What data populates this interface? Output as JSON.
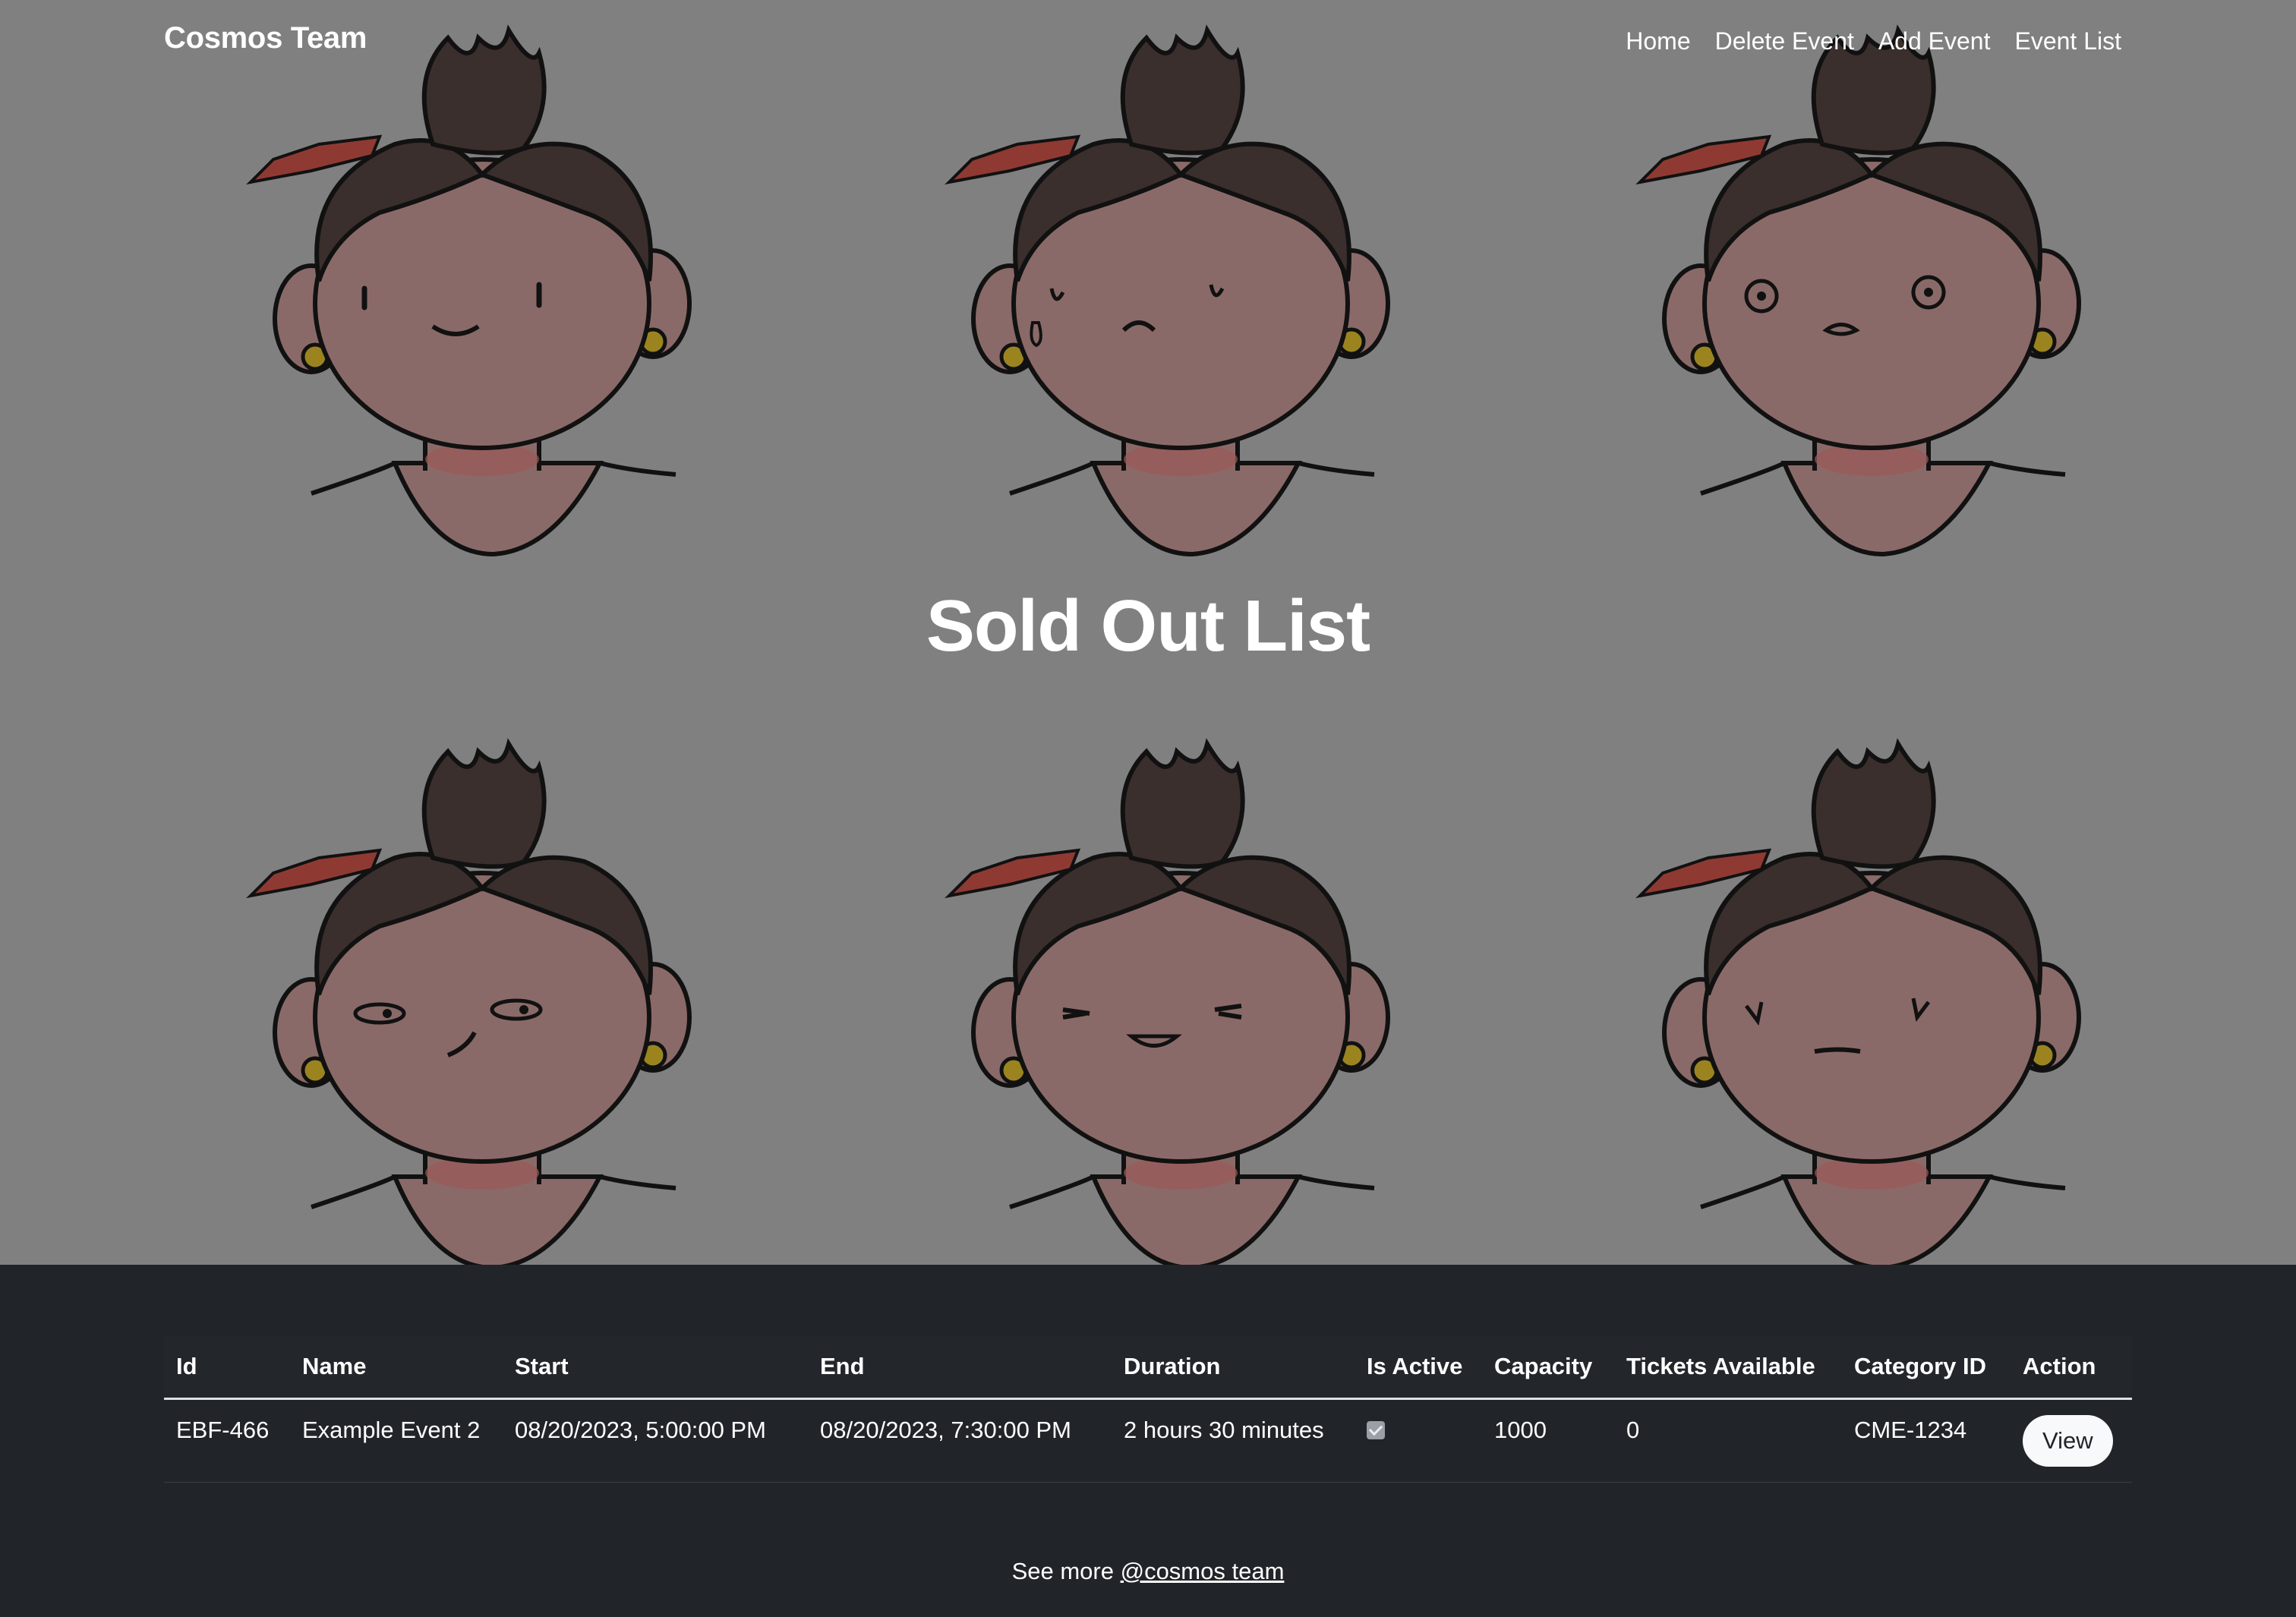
{
  "navbar": {
    "brand": "Cosmos Team",
    "links": [
      "Home",
      "Delete Event",
      "Add Event",
      "Event List"
    ]
  },
  "hero": {
    "title": "Sold Out List",
    "faces": [
      {
        "icon": "smiling-face-icon"
      },
      {
        "icon": "crying-face-icon"
      },
      {
        "icon": "surprised-face-icon"
      },
      {
        "icon": "smirking-face-icon"
      },
      {
        "icon": "happy-squint-face-icon"
      },
      {
        "icon": "angry-face-icon"
      }
    ]
  },
  "table": {
    "headers": [
      "Id",
      "Name",
      "Start",
      "End",
      "Duration",
      "Is Active",
      "Capacity",
      "Tickets Available",
      "Category ID",
      "Action"
    ],
    "rows": [
      {
        "id": "EBF-466",
        "name": "Example Event 2",
        "start": "08/20/2023, 5:00:00 PM",
        "end": "08/20/2023, 7:30:00 PM",
        "duration": "2 hours 30 minutes",
        "is_active": true,
        "capacity": "1000",
        "tickets_available": "0",
        "category_id": "CME-1234",
        "action_label": "View"
      }
    ]
  },
  "footer": {
    "text": "See more",
    "link_label": "@cosmos team"
  },
  "colors": {
    "hero_bg": "#808080",
    "page_bg": "#212529",
    "button_bg": "#f8f9fa"
  }
}
